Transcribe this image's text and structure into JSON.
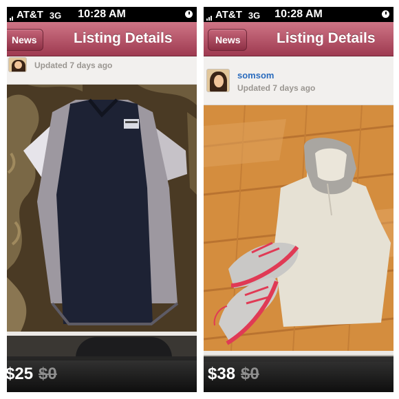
{
  "screens": [
    {
      "status_bar": {
        "carrier": "AT&T",
        "network": "3G",
        "time": "10:28 AM"
      },
      "nav": {
        "back_label": "News",
        "title": "Listing Details"
      },
      "seller": {
        "name": "",
        "updated": "Updated 7 days ago"
      },
      "listing": {
        "price": "$25",
        "original_price": "$0"
      }
    },
    {
      "status_bar": {
        "carrier": "AT&T",
        "network": "3G",
        "time": "10:28 AM"
      },
      "nav": {
        "back_label": "News",
        "title": "Listing Details"
      },
      "seller": {
        "name": "somsom",
        "updated": "Updated 7 days ago"
      },
      "listing": {
        "price": "$38",
        "original_price": "$0"
      }
    }
  ],
  "colors": {
    "nav_bar": "#b24e63",
    "seller_link": "#2a6bbd",
    "price_bar": "#1a1a1a"
  }
}
